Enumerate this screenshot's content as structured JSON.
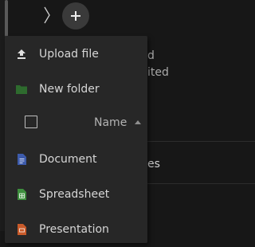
{
  "background": {
    "text_modified": "d",
    "text_edited": "ited",
    "text_files": "es"
  },
  "list_header": {
    "name_label": "Name"
  },
  "menu": {
    "items": [
      {
        "label": "Upload file",
        "icon": "upload-icon"
      },
      {
        "label": "New folder",
        "icon": "folder-icon",
        "color": "#2e6b2e"
      },
      {
        "label": "Document",
        "icon": "document-icon",
        "color": "#3d5bab"
      },
      {
        "label": "Spreadsheet",
        "icon": "spreadsheet-icon",
        "color": "#3e8e3e"
      },
      {
        "label": "Presentation",
        "icon": "presentation-icon",
        "color": "#c85a2a"
      }
    ]
  }
}
